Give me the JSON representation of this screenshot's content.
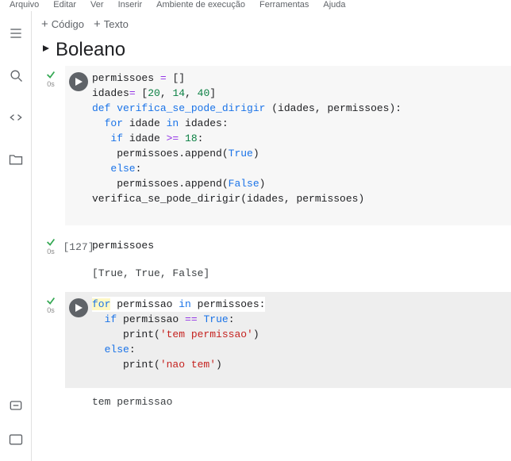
{
  "menu": {
    "arquivo": "Arquivo",
    "editar": "Editar",
    "ver": "Ver",
    "inserir": "Inserir",
    "ambiente": "Ambiente de execução",
    "ferramentas": "Ferramentas",
    "ajuda": "Ajuda"
  },
  "toolbar": {
    "code": "Código",
    "text": "Texto"
  },
  "section": {
    "title": "Boleano"
  },
  "cell1": {
    "status_time": "0s",
    "l1a": "permissoes ",
    "l1b": " []",
    "l2a": "idades",
    "l2b": " [",
    "l2n1": "20",
    "l2c": ", ",
    "l2n2": "14",
    "l2d": ", ",
    "l2n3": "40",
    "l2e": "]",
    "l3a": "def",
    "l3b": " ",
    "l3c": "verifica_se_pode_dirigir",
    "l3d": " (idades, permissoes):",
    "l4a": "  ",
    "l4b": "for",
    "l4c": " idade ",
    "l4d": "in",
    "l4e": " idades:",
    "l5a": "   ",
    "l5b": "if",
    "l5c": " idade ",
    "l5d": ">=",
    "l5e": " ",
    "l5n": "18",
    "l5f": ":",
    "l6a": "    permissoes.append(",
    "l6b": "True",
    "l6c": ")",
    "l7a": "   ",
    "l7b": "else",
    "l7c": ":",
    "l8a": "    permissoes.append(",
    "l8b": "False",
    "l8c": ")",
    "l9": "verifica_se_pode_dirigir(idades, permissoes)"
  },
  "cell2": {
    "exec_count": "[127]",
    "status_time": "0s",
    "code": "permissoes",
    "output": "[True, True, False]"
  },
  "cell3": {
    "status_time": "0s",
    "l1a": "for",
    "l1b": " permissao ",
    "l1c": "in",
    "l1d": " permissoes:",
    "l2a": "  ",
    "l2b": "if",
    "l2c": " permissao ",
    "l2d": "==",
    "l2e": " ",
    "l2f": "True",
    "l2g": ":",
    "l3a": "     print(",
    "l3b": "'tem permissao'",
    "l3c": ")",
    "l4a": "  ",
    "l4b": "else",
    "l4c": ":",
    "l5a": "     print(",
    "l5b": "'nao tem'",
    "l5c": ")",
    "out1": "tem permissao"
  }
}
